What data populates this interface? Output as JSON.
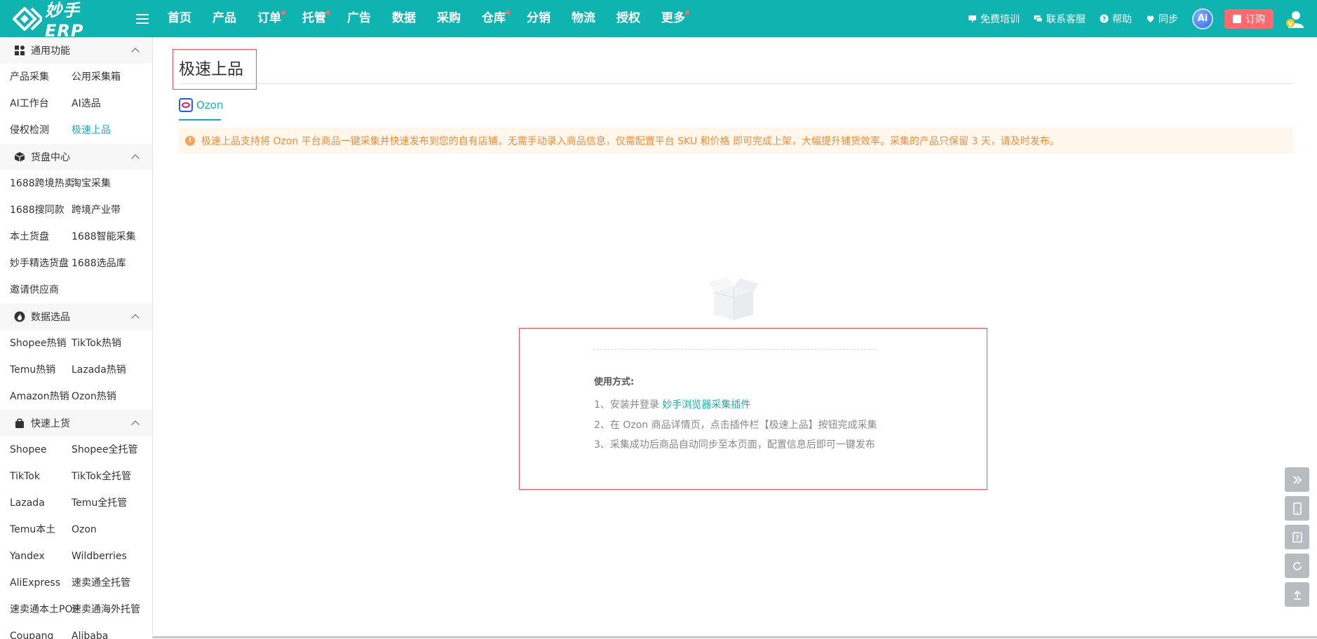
{
  "header": {
    "logo_text": "妙手ERP",
    "nav": [
      {
        "label": "首页",
        "dot": false
      },
      {
        "label": "产品",
        "dot": false
      },
      {
        "label": "订单",
        "dot": true
      },
      {
        "label": "托管",
        "dot": true
      },
      {
        "label": "广告",
        "dot": false
      },
      {
        "label": "数据",
        "dot": false
      },
      {
        "label": "采购",
        "dot": false
      },
      {
        "label": "仓库",
        "dot": true
      },
      {
        "label": "分销",
        "dot": false
      },
      {
        "label": "物流",
        "dot": false
      },
      {
        "label": "授权",
        "dot": false
      },
      {
        "label": "更多",
        "dot": true
      }
    ],
    "right": {
      "training": "免费培训",
      "support": "联系客服",
      "help": "帮助",
      "sync": "同步",
      "ai": "Ai",
      "order": "订购"
    }
  },
  "sidebar": {
    "sections": [
      {
        "title": "通用功能",
        "icon": "grid-icon",
        "items": [
          "产品采集",
          "公用采集箱",
          "AI工作台",
          "AI选品",
          "侵权检测",
          "极速上品"
        ],
        "active": "极速上品"
      },
      {
        "title": "货盘中心",
        "icon": "cube-icon",
        "items": [
          "1688跨境热卖",
          "淘宝采集",
          "1688搜同款",
          "跨境产业带",
          "本土货盘",
          "1688智能采集",
          "妙手精选货盘",
          "1688选品库",
          "邀请供应商"
        ]
      },
      {
        "title": "数据选品",
        "icon": "fire-icon",
        "items": [
          "Shopee热销",
          "TikTok热销",
          "Temu热销",
          "Lazada热销",
          "Amazon热销",
          "Ozon热销"
        ]
      },
      {
        "title": "快速上货",
        "icon": "bag-icon",
        "items": [
          "Shopee",
          "Shopee全托管",
          "TikTok",
          "TikTok全托管",
          "Lazada",
          "Temu全托管",
          "Temu本土",
          "Ozon",
          "Yandex",
          "Wildberries",
          "AliExpress",
          "速卖通全托管",
          "速卖通本土POP",
          "速卖通海外托管",
          "Coupang",
          "Alibaba"
        ]
      }
    ]
  },
  "main": {
    "title": "极速上品",
    "tab": "Ozon",
    "notice": "极速上品支持将 Ozon 平台商品一键采集并快速发布到您的自有店铺，无需手动录入商品信息，仅需配置平台 SKU 和价格 即可完成上架，大幅提升铺货效率。采集的产品只保留 3 天，请及时发布。",
    "usage": {
      "title": "使用方式:",
      "step1_prefix": "1、安装并登录 ",
      "step1_link": "妙手浏览器采集插件",
      "step2": "2、在 Ozon 商品详情页，点击插件栏【极速上品】按钮完成采集",
      "step3": "3、采集成功后商品自动同步至本页面，配置信息后即可一键发布"
    }
  },
  "float_tools": [
    "double-chevron-right-icon",
    "mobile-icon",
    "feedback-icon",
    "refresh-icon",
    "back-to-top-icon"
  ]
}
